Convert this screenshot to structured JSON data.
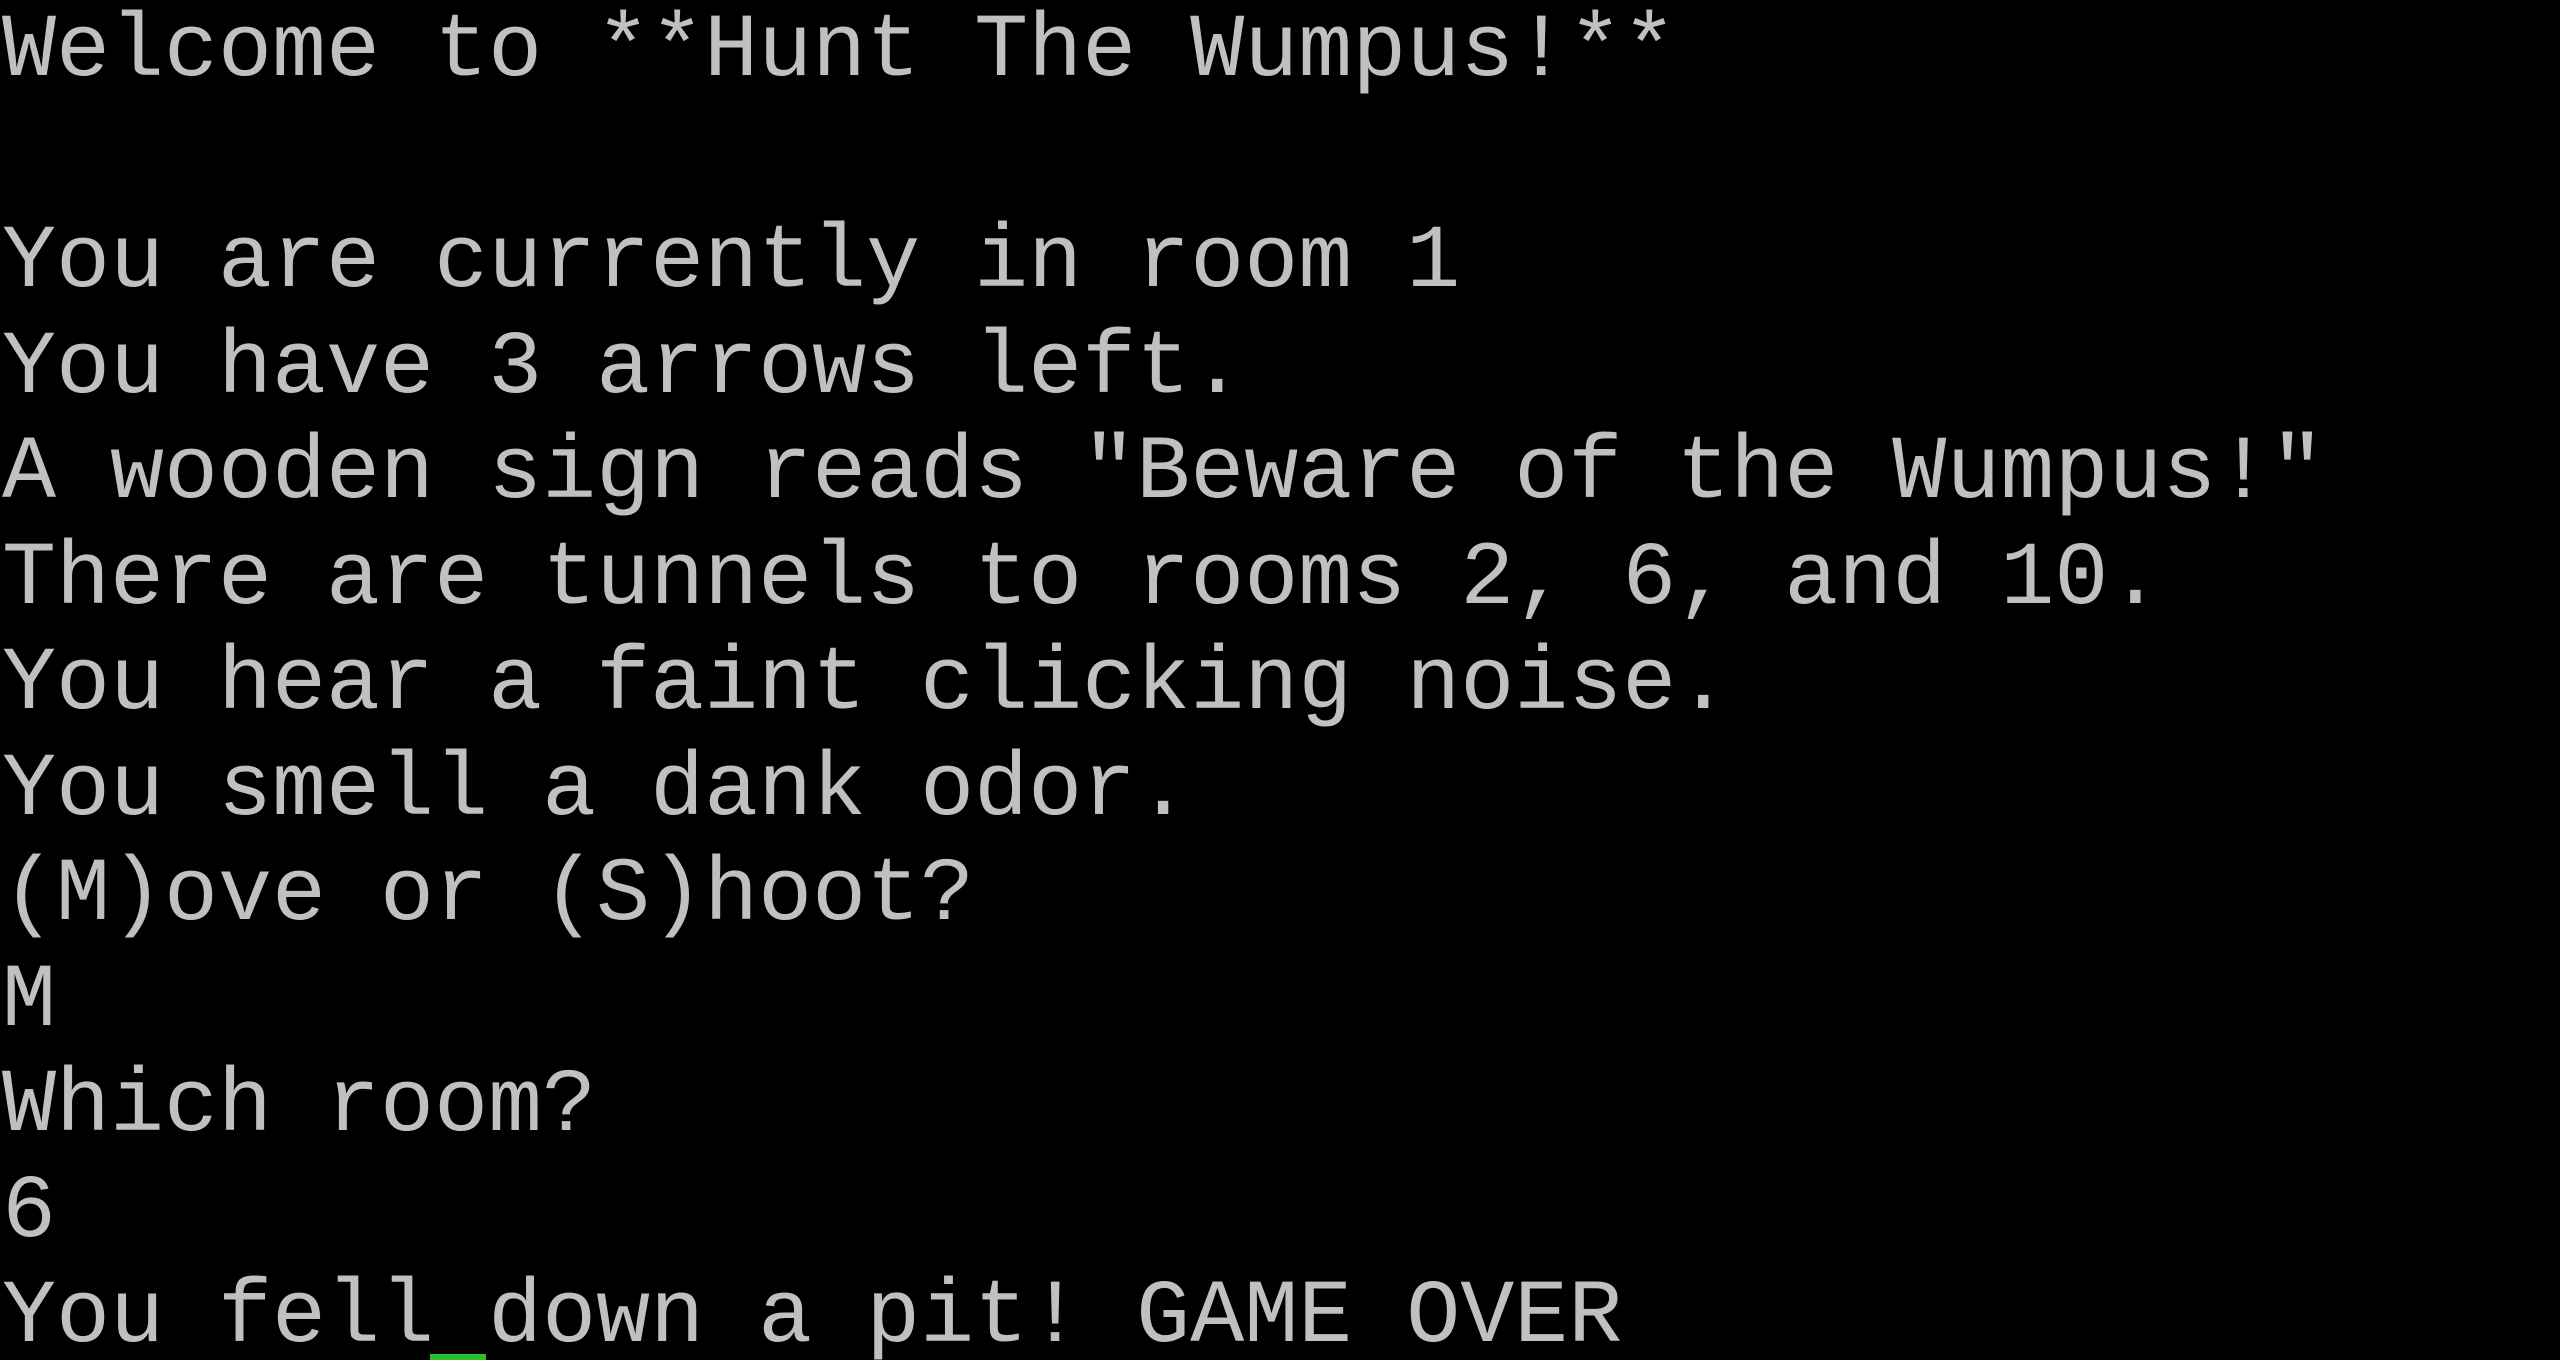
{
  "theme": {
    "background": "#000000",
    "text_color": "#c0c0c0",
    "cursor_color": "#2bbf2b"
  },
  "terminal": {
    "lines": [
      "Welcome to **Hunt The Wumpus!**",
      "",
      "You are currently in room 1",
      "You have 3 arrows left.",
      "A wooden sign reads \"Beware of the Wumpus!\"",
      "There are tunnels to rooms 2, 6, and 10.",
      "You hear a faint clicking noise.",
      "You smell a dank odor.",
      "(M)ove or (S)hoot?",
      "M",
      "Which room?",
      "6",
      "You fell down a pit! GAME OVER"
    ]
  }
}
